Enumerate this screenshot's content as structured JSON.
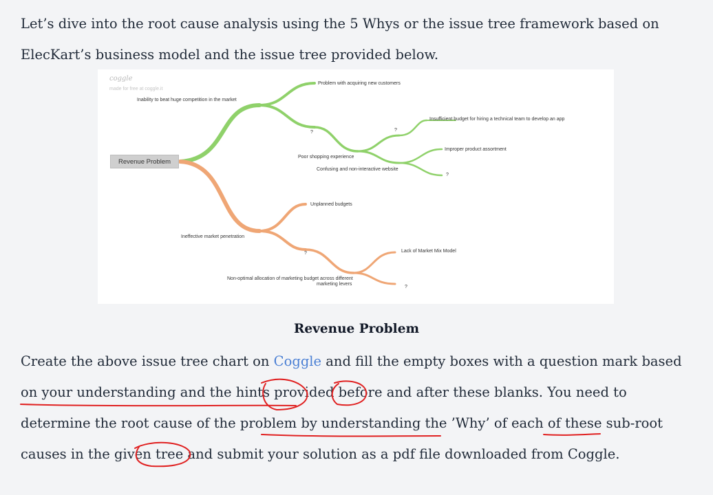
{
  "intro_text": "Let’s dive into the root cause analysis using the 5 Whys or the issue tree framework based on ElecKart’s business model and the issue tree provided below.",
  "mindmap": {
    "brand": "coggle",
    "brand_sub": "made for free at coggle.it",
    "root": "Revenue Problem",
    "nodes": {
      "inability": "Inability to beat huge competition in the market",
      "acquiring": "Problem with acquiring new customers",
      "q_green_1": "?",
      "q_green_2": "?",
      "budget_app": "Insufficient budget for hiring a technical team to develop an app",
      "assortment": "Improper product assortment",
      "q_green_3": "?",
      "poor_shopping": "Poor shopping experience",
      "confusing": "Confusing and non-interactive website",
      "ineffective": "Ineffective market penetration",
      "unplanned": "Unplanned budgets",
      "q_orange_1": "?",
      "mix_model": "Lack of Market Mix Model",
      "nonoptimal_1": "Non-optimal allocation of marketing budget across different",
      "nonoptimal_2": "marketing levers",
      "q_orange_2": "?"
    },
    "colors": {
      "green": "#8fd16a",
      "orange": "#efa675"
    }
  },
  "caption": "Revenue Problem",
  "body": {
    "before_link": "Create the above issue tree chart on ",
    "link": "Coggle",
    "after_link": " and fill the empty boxes with a question mark based on your understanding and the hints provided before and after these blanks. You need to determine the root cause of the problem by understanding the ’Why’ of each of these sub-root causes in the given tree and submit your solution as a pdf file downloaded from Coggle."
  }
}
